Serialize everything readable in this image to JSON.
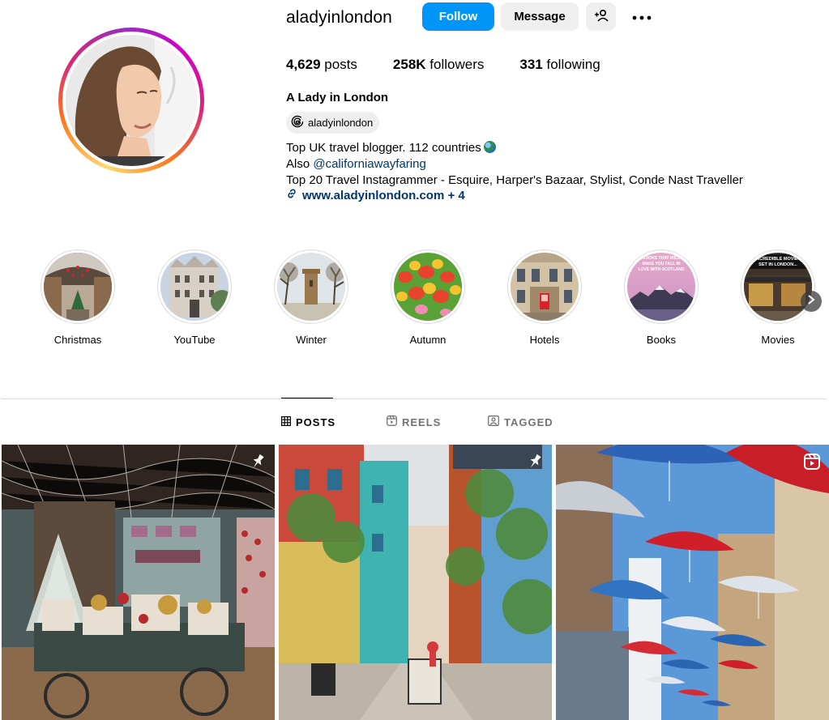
{
  "profile": {
    "username": "aladyinlondon",
    "follow_label": "Follow",
    "message_label": "Message",
    "posts_count": "4,629",
    "posts_label": "posts",
    "followers_count": "258K",
    "followers_label": "followers",
    "following_count": "331",
    "following_label": "following",
    "full_name": "A Lady in London",
    "threads_handle": "aladyinlondon",
    "bio_line1": "Top UK travel blogger. 112 countries",
    "bio_line2_prefix": "Also ",
    "bio_line2_mention": "@californiawayfaring",
    "bio_line3": "Top 20 Travel Instagrammer - Esquire, Harper's Bazaar, Stylist, Conde Nast Traveller",
    "link_text": "www.aladyinlondon.com",
    "link_more": " + 4"
  },
  "highlights": [
    {
      "label": "Christmas",
      "image": "victorian-arcade-with-christmas-tree"
    },
    {
      "label": "YouTube",
      "image": "london-gothic-building"
    },
    {
      "label": "Winter",
      "image": "stone-tower-with-bare-trees"
    },
    {
      "label": "Autumn",
      "image": "red-and-yellow-tulips"
    },
    {
      "label": "Hotels",
      "image": "stone-building-with-red-phone-box"
    },
    {
      "label": "Books",
      "image": "snowy-mountains-at-sunset"
    },
    {
      "label": "Movies",
      "image": "pub-facade-with-text-overlay"
    }
  ],
  "books_overlay": "BOOKS THAT WILL MAKE YOU FALL IN LOVE WITH SCOTLAND",
  "movies_overlay": "INCREDIBLE MOVIES SET IN LONDON",
  "tabs": [
    {
      "label": "POSTS",
      "icon": "grid-icon",
      "active": true
    },
    {
      "label": "REELS",
      "icon": "reels-icon",
      "active": false
    },
    {
      "label": "TAGGED",
      "icon": "tagged-icon",
      "active": false
    }
  ],
  "posts": [
    {
      "image": "christmas-shop-with-cart",
      "badge": "pin-icon"
    },
    {
      "image": "colourful-courtyard-neals-yard",
      "badge": "pin-icon"
    },
    {
      "image": "umbrellas-over-alley",
      "badge": "reel-icon"
    }
  ],
  "colors": {
    "accent": "#0095f6",
    "link": "#00376b",
    "muted": "#737373"
  }
}
